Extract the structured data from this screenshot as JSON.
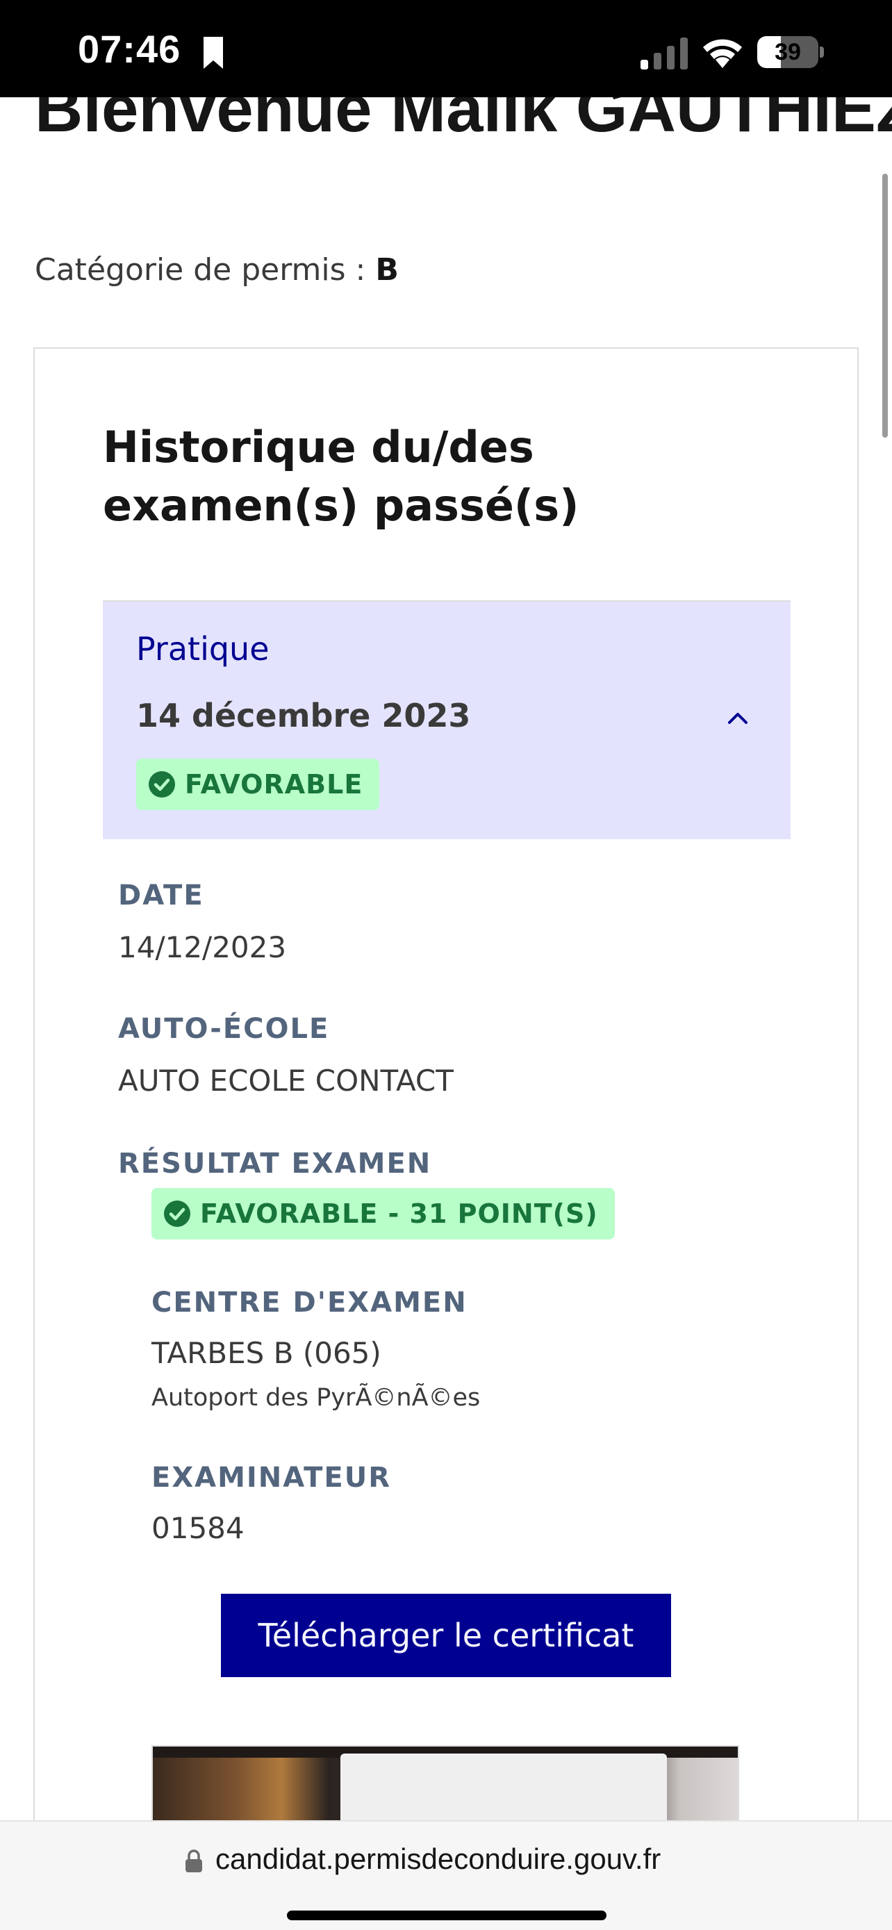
{
  "status_bar": {
    "time": "07:46",
    "battery_level": "39",
    "battery_percent": 39
  },
  "header": {
    "welcome": "Bienvenue Malik GAUTHIEZ",
    "category_label": "Catégorie de permis : ",
    "category_value": "B"
  },
  "card": {
    "title": "Historique du/des examen(s) passé(s)",
    "accordion": {
      "type": "Pratique",
      "date": "14 décembre 2023",
      "status": "FAVORABLE",
      "expanded": true
    },
    "details": {
      "date_label": "DATE",
      "date_value": "14/12/2023",
      "school_label": "AUTO-ÉCOLE",
      "school_value": "AUTO ECOLE CONTACT",
      "result_label": "RÉSULTAT EXAMEN",
      "result_value": "FAVORABLE - 31 POINT(S)",
      "center_label": "CENTRE D'EXAMEN",
      "center_value": "TARBES B (065)",
      "center_address": "Autoport des PyrÃ©nÃ©es",
      "examiner_label": "EXAMINATEUR",
      "examiner_value": "01584"
    },
    "download_button": "Télécharger le certificat"
  },
  "browser": {
    "url": "candidat.permisdeconduire.gouv.fr"
  },
  "colors": {
    "primary": "#000091",
    "accordion_bg": "#e3e3fd",
    "success_bg": "#b8fec9",
    "success_text": "#18753c",
    "label": "#53657d"
  }
}
